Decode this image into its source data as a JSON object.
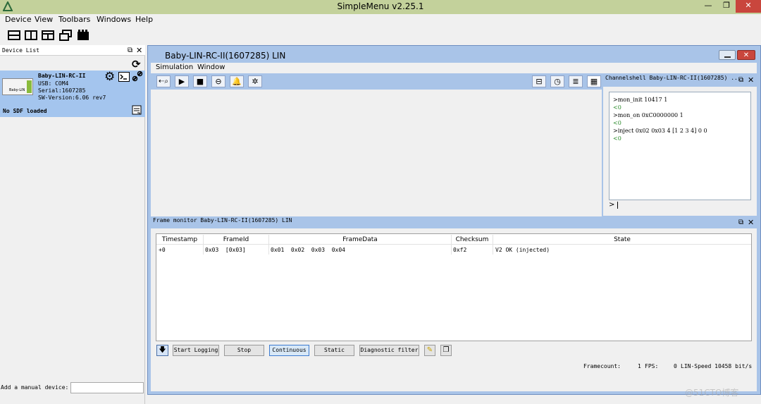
{
  "app": {
    "title": "SimpleMenu v2.25.1"
  },
  "window_controls": {
    "minimize": "—",
    "restore": "❐",
    "close": "✕"
  },
  "menu": {
    "items": [
      "Device",
      "View",
      "Toolbars",
      "Windows",
      "Help"
    ]
  },
  "device_list": {
    "title": "Device List",
    "device": {
      "name": "Baby-LIN-RC-II",
      "usb": "USB: COM4",
      "serial": "Serial:1607285",
      "sw_version": "SW-Version:6.06 rev7",
      "thumb_label": "Baby-LIN"
    },
    "sdf_status": "No SDF loaded",
    "manual_label": "Add a manual device:",
    "manual_value": ""
  },
  "sub_window": {
    "title": "Baby-LIN-RC-II(1607285) LIN",
    "menu": [
      "Simulation",
      "Window"
    ]
  },
  "channelshell": {
    "title": "Channelshell Baby-LIN-RC-II(1607285) ...",
    "lines": [
      {
        "text": ">mon_init 10417 1",
        "color": "#000000"
      },
      {
        "text": "<0",
        "color": "#2a8a2a"
      },
      {
        "text": ">mon_on 0xC0000000 1",
        "color": "#000000"
      },
      {
        "text": "<0",
        "color": "#2a8a2a"
      },
      {
        "text": ">inject 0x02 0x03 4 [1 2 3 4] 0 0",
        "color": "#000000"
      },
      {
        "text": "<0",
        "color": "#2a8a2a"
      }
    ],
    "prompt": ">",
    "input_value": ""
  },
  "frame_monitor": {
    "title": "Frame monitor Baby-LIN-RC-II(1607285) LIN",
    "columns": [
      "Timestamp",
      "FrameId",
      "FrameData",
      "Checksum",
      "State"
    ],
    "rows": [
      [
        "+0",
        "0x03  [0x03]",
        "0x01  0x02  0x03  0x04",
        "0xf2",
        "V2 OK (injected)"
      ]
    ],
    "buttons": {
      "start_logging": "Start Logging",
      "stop": "Stop",
      "continuous": "Continuous",
      "static": "Static",
      "diagnostic_filter": "Diagnostic filter"
    },
    "status": {
      "framecount_label": "Framecount:",
      "framecount": "1",
      "fps_label": "FPS:",
      "fps": "0",
      "lin_speed": "LIN-Speed 10458 bit/s"
    }
  },
  "watermark": "@51CTO博客",
  "colors": {
    "titlebar": "#c3d19b",
    "panel_blue": "#a9c4e8",
    "selected_device": "#a4c5ee",
    "close_red": "#c9463d"
  }
}
